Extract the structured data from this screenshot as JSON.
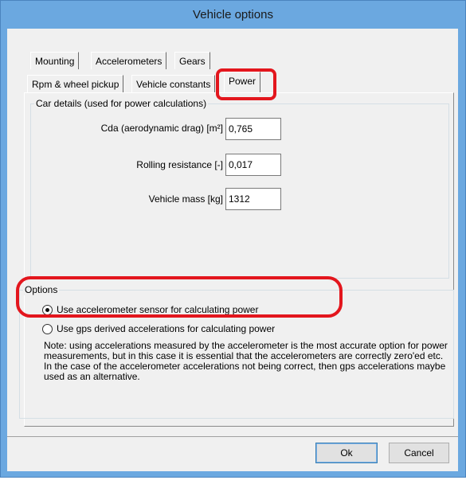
{
  "window": {
    "title": "Vehicle options"
  },
  "tabs_row1": [
    {
      "label": "Mounting"
    },
    {
      "label": "Accelerometers"
    },
    {
      "label": "Gears"
    }
  ],
  "tabs_row2": [
    {
      "label": "Rpm & wheel pickup"
    },
    {
      "label": "Vehicle constants"
    },
    {
      "label": "Power",
      "active": true
    }
  ],
  "car_details": {
    "title": "Car details (used for power calculations)",
    "cda_label": "Cda (aerodynamic drag) [m²]",
    "cda_value": "0,765",
    "rolling_label": "Rolling resistance [-]",
    "rolling_value": "0,017",
    "mass_label": "Vehicle mass [kg]",
    "mass_value": "1312"
  },
  "options": {
    "title": "Options",
    "radio_accel_label": "Use accelerometer sensor for calculating power",
    "radio_accel_checked": true,
    "radio_gps_label": "Use gps derived accelerations for calculating power",
    "radio_gps_checked": false,
    "note": "Note: using accelerations measured by the accelerometer is the most accurate option for power measurements, but in this case it is essential that the accelerometers are correctly zero'ed etc. In the case of the accelerometer accelerations not being correct, then gps accelerations maybe used as an alternative."
  },
  "buttons": {
    "ok_label": "Ok",
    "cancel_label": "Cancel"
  },
  "colors": {
    "title_bar": "#6ba8e0",
    "highlight": "#e3161d"
  }
}
